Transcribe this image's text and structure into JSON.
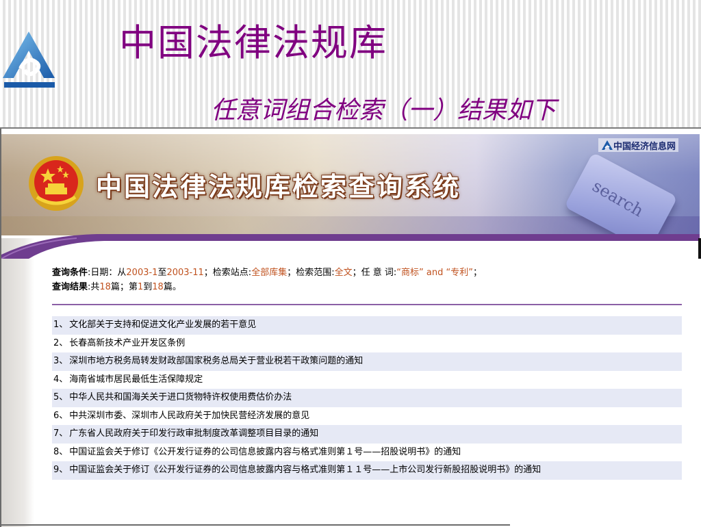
{
  "slide": {
    "title": "中国法律法规库",
    "subtitle": "任意词组合检索（一）结果如下"
  },
  "banner": {
    "system_title": "中国法律法规库检索查询系统",
    "partner_logo": "中国经济信息网",
    "key_label": "search"
  },
  "query": {
    "condition_label": "查询条件",
    "date_label": ":日期：从",
    "date_from": "2003-1",
    "date_to_word": "至",
    "date_to": "2003-11",
    "site_label": "；检索站点:",
    "site_value": "全部库集",
    "scope_label": "；检索范围:",
    "scope_value": "全文",
    "keyword_label": "；任 意 词:",
    "keyword_value": "“商标” and “专利”",
    "end_semicolon": "；",
    "result_label": "查询结果",
    "result_prefix": ":共",
    "total": "18",
    "result_mid": "篇；第",
    "page_from": "1",
    "page_to_word": "到",
    "page_to": "18",
    "result_suffix": "篇。"
  },
  "results": [
    {
      "num": "1、",
      "title": "文化部关于支持和促进文化产业发展的若干意见"
    },
    {
      "num": "2、",
      "title": "长春高新技术产业开发区条例"
    },
    {
      "num": "3、",
      "title": "深圳市地方税务局转发财政部国家税务总局关于营业税若干政策问题的通知"
    },
    {
      "num": "4、",
      "title": "海南省城市居民最低生活保障规定"
    },
    {
      "num": "5、",
      "title": "中华人民共和国海关关于进口货物特许权使用费估价办法"
    },
    {
      "num": "6、",
      "title": "中共深圳市委、深圳市人民政府关于加快民营经济发展的意见"
    },
    {
      "num": "7、",
      "title": "广东省人民政府关于印发行政审批制度改革调整项目目录的通知"
    },
    {
      "num": "8、",
      "title": "中国证监会关于修订《公开发行证券的公司信息披露内容与格式准则第１号——招股说明书》的通知"
    },
    {
      "num": "9、",
      "title": "中国证监会关于修订《公开发行证券的公司信息披露内容与格式准则第１１号——上市公司发行新股招股说明书》的通知"
    }
  ],
  "colors": {
    "slide_title": "#800080",
    "highlight": "#c0521f",
    "divider": "#8b5fa6",
    "row_alt": "#e6e9f5"
  },
  "icons": [
    "slide-logo-icon",
    "national-emblem-icon",
    "partner-logo-icon",
    "keyboard-key-icon"
  ]
}
